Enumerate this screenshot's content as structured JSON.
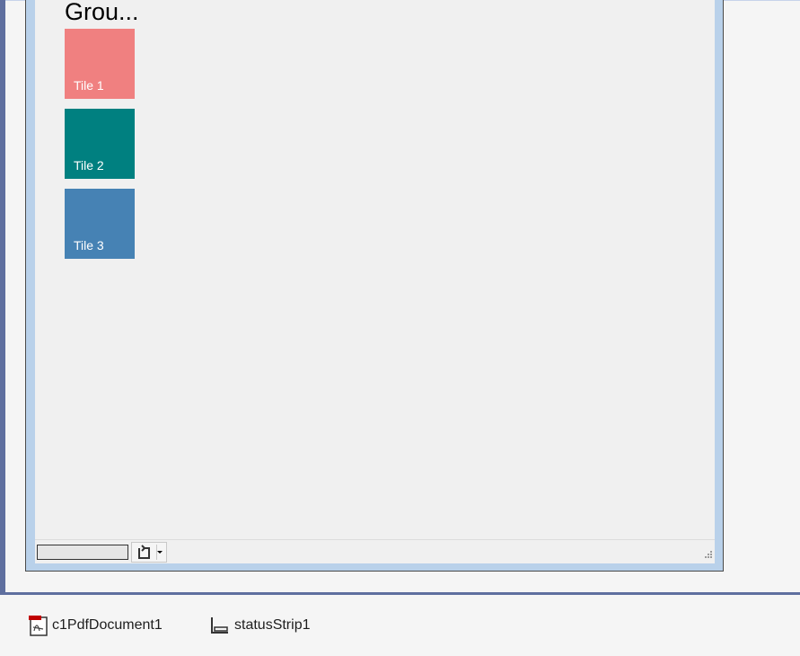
{
  "group": {
    "title": "Grou..."
  },
  "tiles": [
    {
      "label": "Tile 1",
      "color": "#f08080"
    },
    {
      "label": "Tile 2",
      "color": "#008080"
    },
    {
      "label": "Tile 3",
      "color": "#4682b4"
    }
  ],
  "status_strip": {
    "progress_value": 0,
    "split_button_icon": "refresh-icon"
  },
  "component_tray": {
    "items": [
      {
        "label": "c1PdfDocument1",
        "icon": "pdf-document-icon"
      },
      {
        "label": "statusStrip1",
        "icon": "status-strip-icon"
      }
    ]
  },
  "colors": {
    "designer_border": "#5f6f9f",
    "form_frame": "#b9d1ea",
    "form_background": "#f0f0f0"
  }
}
